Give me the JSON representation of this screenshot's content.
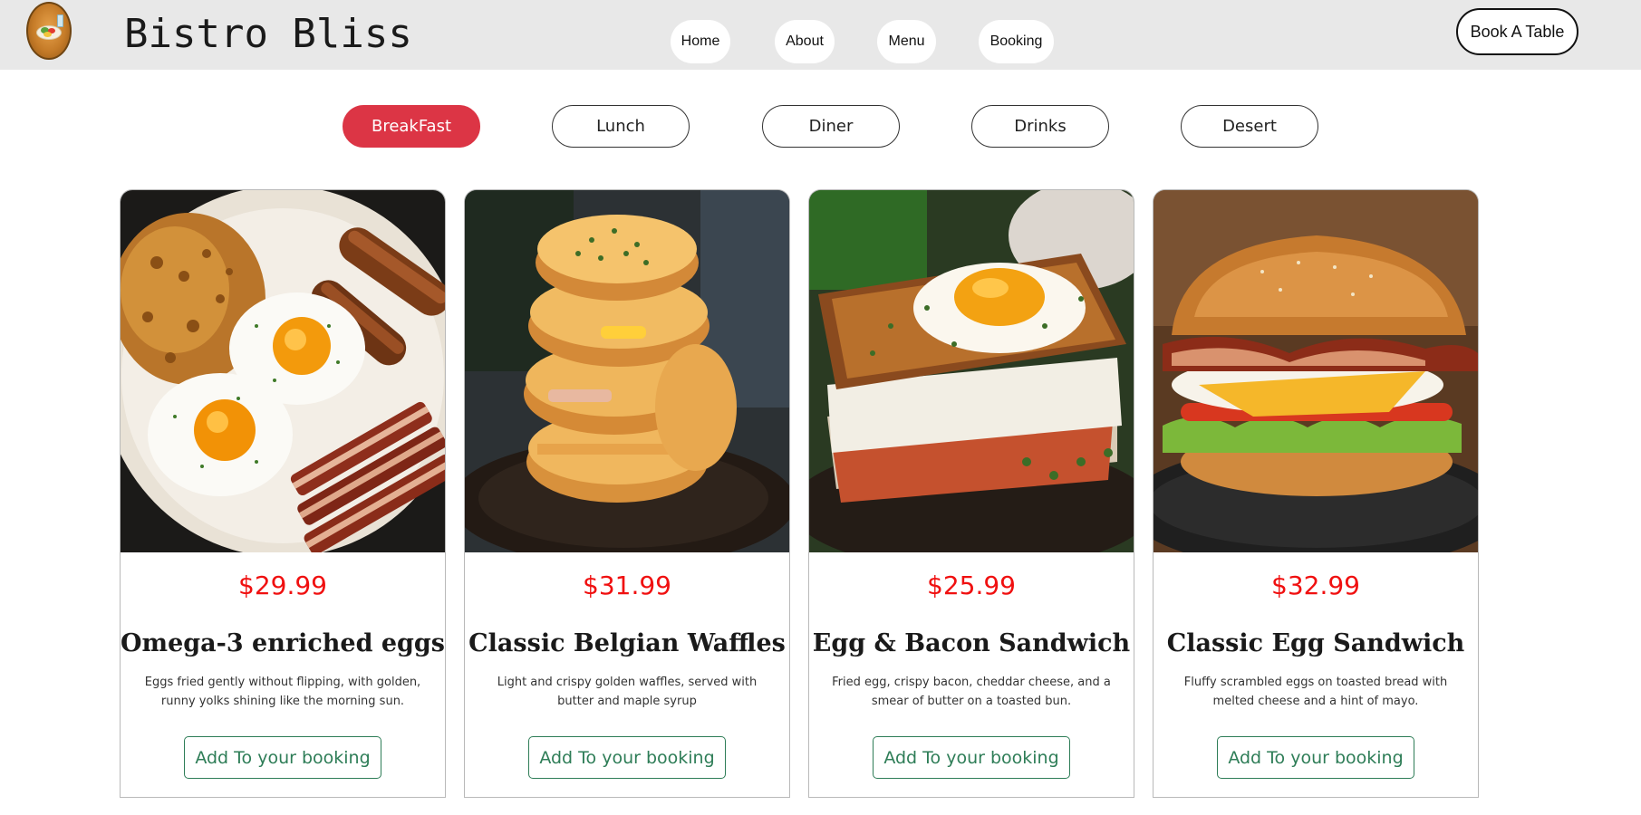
{
  "header": {
    "brand": "Bistro Bliss",
    "nav": [
      "Home",
      "About",
      "Menu",
      "Booking"
    ],
    "cta": "Book A Table"
  },
  "categories": {
    "items": [
      "BreakFast",
      "Lunch",
      "Diner",
      "Drinks",
      "Desert"
    ],
    "active": "BreakFast"
  },
  "menu": {
    "items": [
      {
        "price": "$29.99",
        "title": "Omega-3 enriched eggs",
        "description": "Eggs fried gently without flipping, with golden, runny yolks shining like the morning sun.",
        "button": "Add To your booking"
      },
      {
        "price": "$31.99",
        "title": "Classic Belgian Waffles",
        "description": "Light and crispy golden waffles, served with butter and maple syrup",
        "button": "Add To your booking"
      },
      {
        "price": "$25.99",
        "title": "Egg & Bacon Sandwich",
        "description": "Fried egg, crispy bacon, cheddar cheese, and a smear of butter on a toasted bun.",
        "button": "Add To your booking"
      },
      {
        "price": "$32.99",
        "title": "Classic Egg Sandwich",
        "description": "Fluffy scrambled eggs on toasted bread with melted cheese and a hint of mayo.",
        "button": "Add To your booking"
      }
    ]
  },
  "colors": {
    "header_bg": "#e8e8e8",
    "active_tab": "#dc3545",
    "price": "#f01010",
    "add_button": "#2e7d57"
  }
}
